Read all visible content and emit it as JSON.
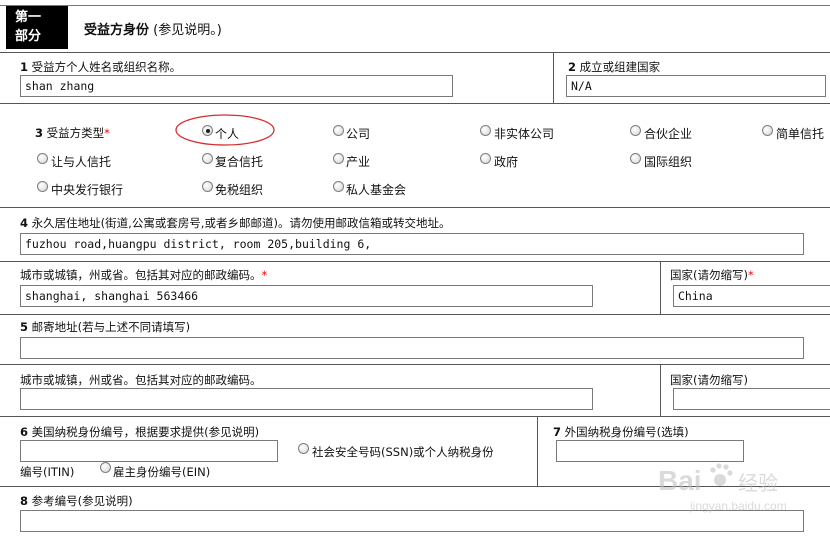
{
  "header": {
    "part_line1": "第一",
    "part_line2": "部分",
    "title": "受益方身份",
    "title_note": "(参见说明。)"
  },
  "f1": {
    "num": "1",
    "label": "受益方个人姓名或组织名称。",
    "value": "shan zhang"
  },
  "f2": {
    "num": "2",
    "label": "成立或组建国家",
    "value": "N/A"
  },
  "f3": {
    "num": "3",
    "label": "受益方类型",
    "req": "*",
    "options": [
      "个人",
      "公司",
      "非实体公司",
      "合伙企业",
      "简单信托",
      "让与人信托",
      "复合信托",
      "产业",
      "政府",
      "国际组织",
      "中央发行银行",
      "免税组织",
      "私人基金会"
    ],
    "selected": "个人",
    "highlight_color": "#d32f2f"
  },
  "f4": {
    "num": "4",
    "label": "永久居住地址(街道,公寓或套房号,或者乡邮邮道)。请勿使用邮政信箱或转交地址。",
    "value": "fuzhou road,huangpu district, room 205,building 6,"
  },
  "city1": {
    "label": "城市或城镇，州或省。包括其对应的邮政编码。",
    "req": "*",
    "value": "shanghai, shanghai 563466"
  },
  "country1": {
    "label": "国家(请勿缩写)",
    "req": "*",
    "value": "China"
  },
  "f5": {
    "num": "5",
    "label": "邮寄地址(若与上述不同请填写)",
    "value": ""
  },
  "city2": {
    "label": "城市或城镇，州或省。包括其对应的邮政编码。",
    "value": ""
  },
  "country2": {
    "label": "国家(请勿缩写)",
    "value": ""
  },
  "f6": {
    "num": "6",
    "label": "美国纳税身份编号，根据要求提供(参见说明)",
    "opt_ssn": "社会安全号码(SSN)或个人纳税身份",
    "opt_ssn_cont": "编号(ITIN)",
    "opt_ein": "雇主身份编号(EIN)",
    "value": ""
  },
  "f7": {
    "num": "7",
    "label": "外国纳税身份编号(选填)",
    "value": ""
  },
  "f8": {
    "num": "8",
    "label": "参考编号(参见说明)",
    "value": ""
  },
  "watermark": {
    "brand": "Bai",
    "brand2": "经验",
    "url": "jingyan.baidu.com"
  }
}
